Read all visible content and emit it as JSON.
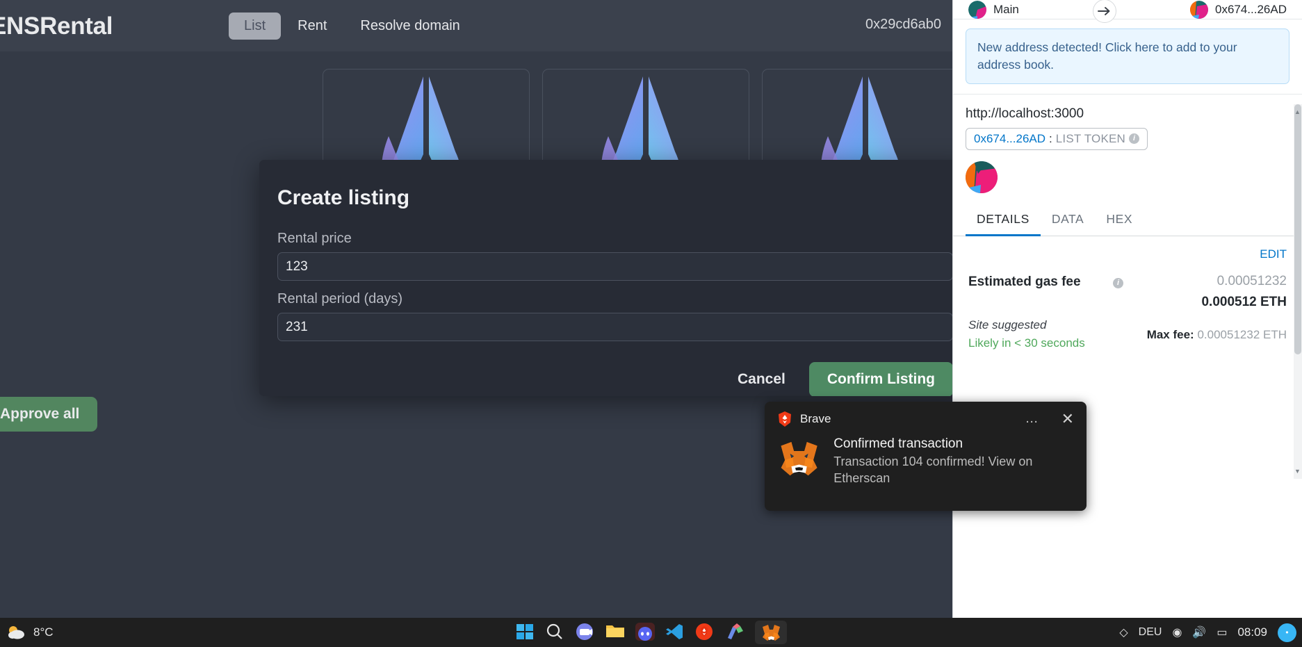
{
  "app": {
    "brand": "ENSRental",
    "nav": {
      "active_tab": "List",
      "links": [
        "Rent",
        "Resolve domain"
      ]
    },
    "wallet_address": "0x29cd6ab0",
    "approve_all_label": "Approve all"
  },
  "modal": {
    "title": "Create listing",
    "fields": [
      {
        "label": "Rental price",
        "value": "123",
        "placeholder": ""
      },
      {
        "label": "Rental period (days)",
        "value": "231",
        "placeholder": ""
      }
    ],
    "cancel_label": "Cancel",
    "confirm_label": "Confirm Listing"
  },
  "metamask": {
    "from_account": "Main",
    "to_account": "0x674...26AD",
    "notice": "New address detected! Click here to add to your address book.",
    "origin": "http://localhost:3000",
    "token_addr": "0x674...26AD",
    "token_sep": ":",
    "token_action": "LIST TOKEN",
    "tabs": [
      {
        "label": "DETAILS",
        "active": true
      },
      {
        "label": "DATA",
        "active": false
      },
      {
        "label": "HEX",
        "active": false
      }
    ],
    "edit_label": "EDIT",
    "gas_label": "Estimated gas fee",
    "gas_native": "0.00051232",
    "gas_eth": "0.000512 ETH",
    "site_suggested": "Site suggested",
    "likely_time": "Likely in < 30 seconds",
    "max_fee_label": "Max fee:",
    "max_fee_value": "0.00051232 ETH",
    "colors": {
      "accent": "#0376c9",
      "notice_bg": "#eaf6ff",
      "notice_text": "#37618c",
      "success": "#4fa85b"
    }
  },
  "toast": {
    "app_name": "Brave",
    "title": "Confirmed transaction",
    "body": "Transaction 104 confirmed! View on Etherscan",
    "more_label": "…",
    "close_label": "✕"
  },
  "taskbar": {
    "temperature": "8°C",
    "clock_time": "08:09",
    "tray_labels": [
      "DEU"
    ],
    "icons": [
      "windows-start-icon",
      "search-icon",
      "teams-icon",
      "file-explorer-icon",
      "discord-icon",
      "vscode-icon",
      "brave-icon",
      "paint-icon",
      "metamask-icon"
    ]
  }
}
